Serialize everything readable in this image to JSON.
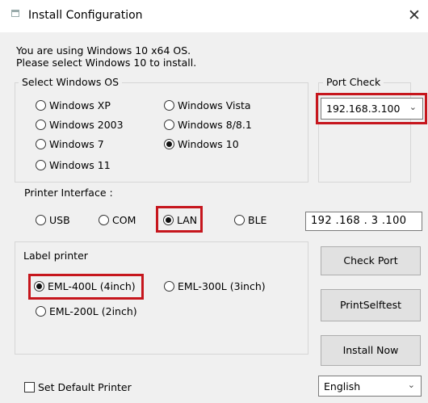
{
  "window": {
    "title": "Install Configuration",
    "close_glyph": "✕"
  },
  "info": {
    "line1": "You are using Windows 10 x64 OS.",
    "line2": "Please select Windows 10 to install."
  },
  "os_group": {
    "label": "Select Windows OS",
    "options": [
      "Windows XP",
      "Windows Vista",
      "Windows 2003",
      "Windows 8/8.1",
      "Windows 7",
      "Windows 10",
      "Windows 11"
    ],
    "selected": "Windows 10"
  },
  "port_check": {
    "label": "Port Check",
    "value": "192.168.3.100"
  },
  "interface": {
    "label": "Printer Interface :",
    "options": [
      "USB",
      "COM",
      "LAN",
      "BLE"
    ],
    "selected": "LAN",
    "ip_value": "192 .168 . 3 .100"
  },
  "label_printer": {
    "label": "Label printer",
    "options": [
      "EML-400L (4inch)",
      "EML-300L (3inch)",
      "EML-200L (2inch)"
    ],
    "selected": "EML-400L (4inch)"
  },
  "buttons": {
    "check_port": "Check Port",
    "print_selftest": "PrintSelftest",
    "install_now": "Install Now"
  },
  "default_printer": {
    "label": "Set Default Printer",
    "checked": false
  },
  "language": {
    "value": "English"
  },
  "colors": {
    "highlight": "#c6161d",
    "background": "#f0f0f0"
  }
}
